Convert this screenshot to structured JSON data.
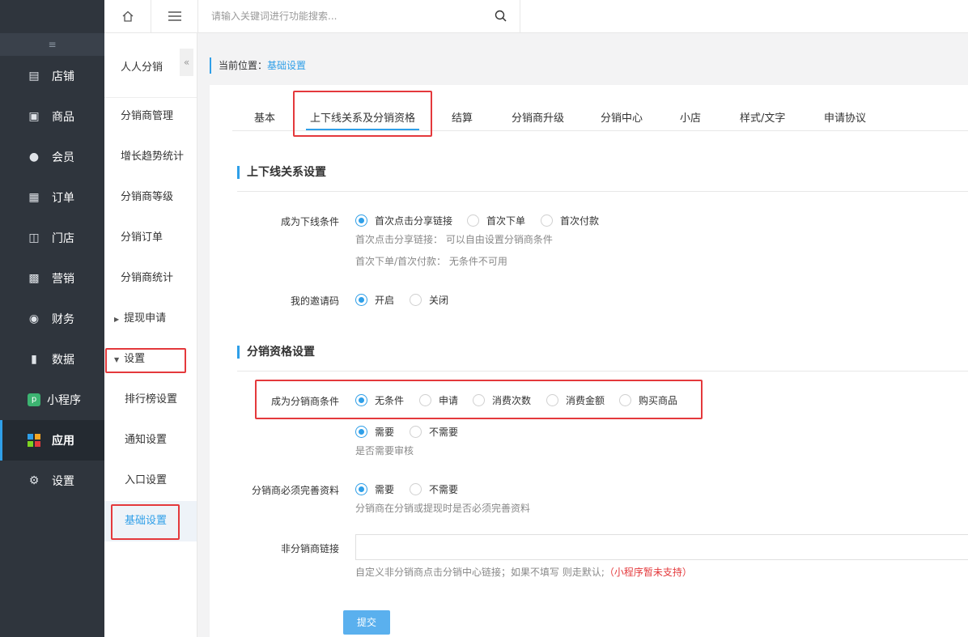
{
  "sidebar_main": {
    "collapse_icon": "collapse-menu-icon",
    "items": [
      {
        "label": "店铺",
        "icon": "store-icon"
      },
      {
        "label": "商品",
        "icon": "goods-icon"
      },
      {
        "label": "会员",
        "icon": "member-icon"
      },
      {
        "label": "订单",
        "icon": "order-icon"
      },
      {
        "label": "门店",
        "icon": "shop-icon"
      },
      {
        "label": "营销",
        "icon": "gift-icon"
      },
      {
        "label": "财务",
        "icon": "money-bag-icon"
      },
      {
        "label": "数据",
        "icon": "chart-icon"
      },
      {
        "label": "小程序",
        "icon": "miniapp-icon"
      },
      {
        "label": "应用",
        "icon": "apps-icon"
      },
      {
        "label": "设置",
        "icon": "gear-icon"
      }
    ],
    "active": "应用"
  },
  "sidebar_sub": {
    "title": "人人分销",
    "items": [
      "分销商管理",
      "增长趋势统计",
      "分销商等级",
      "分销订单",
      "分销商统计",
      "提现申请",
      "设置",
      "排行榜设置",
      "通知设置",
      "入口设置",
      "基础设置"
    ],
    "active": "基础设置"
  },
  "topbar": {
    "search_placeholder": "请输入关键词进行功能搜索..."
  },
  "breadcrumb": {
    "prefix": "当前位置：",
    "current": "基础设置"
  },
  "tabs": [
    "基本",
    "上下线关系及分销资格",
    "结算",
    "分销商升级",
    "分销中心",
    "小店",
    "样式/文字",
    "申请协议"
  ],
  "active_tab": "上下线关系及分销资格",
  "section1": {
    "title": "上下线关系设置",
    "downline_condition": {
      "label": "成为下线条件",
      "options": [
        "首次点击分享链接",
        "首次下单",
        "首次付款"
      ],
      "selected": "首次点击分享链接",
      "hint1": "首次点击分享链接：  可以自由设置分销商条件",
      "hint2": "首次下单/首次付款：  无条件不可用"
    },
    "invite_code": {
      "label": "我的邀请码",
      "options": [
        "开启",
        "关闭"
      ],
      "selected": "开启"
    }
  },
  "section2": {
    "title": "分销资格设置",
    "distributor_condition": {
      "label": "成为分销商条件",
      "options": [
        "无条件",
        "申请",
        "消费次数",
        "消费金额",
        "购买商品"
      ],
      "selected": "无条件"
    },
    "review": {
      "options": [
        "需要",
        "不需要"
      ],
      "selected": "需要",
      "hint": "是否需要审核"
    },
    "complete_info": {
      "label": "分销商必须完善资料",
      "options": [
        "需要",
        "不需要"
      ],
      "selected": "需要",
      "hint": "分销商在分销或提现时是否必须完善资料"
    },
    "non_distributor_link": {
      "label": "非分销商链接",
      "value": "",
      "hint": "自定义非分销商点击分销中心链接；如果不填写 则走默认;",
      "hint_red": "（小程序暂未支持）"
    }
  },
  "submit_label": "提交",
  "colors": {
    "accent": "#2f9fe8",
    "sidebar_bg": "#2f353d",
    "highlight_box": "#e4393c"
  }
}
